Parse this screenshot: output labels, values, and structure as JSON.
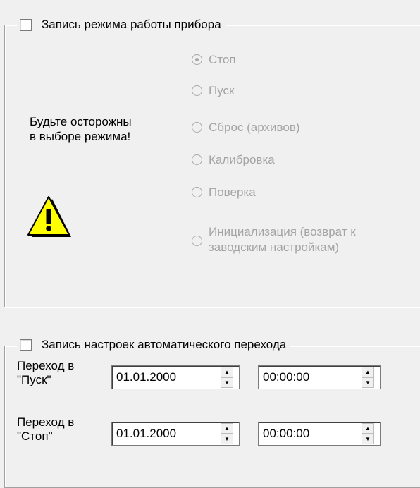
{
  "mode_group": {
    "title": "Запись режима работы прибора",
    "checked": false,
    "warning_line1": "Будьте осторожны",
    "warning_line2": "в выборе режима!",
    "warning_icon": "warning-icon",
    "options": [
      {
        "line1": "Стоп",
        "line2": "",
        "selected": true
      },
      {
        "line1": "Пуск",
        "line2": "",
        "selected": false
      },
      {
        "line1": "Сброс (архивов)",
        "line2": "",
        "selected": false
      },
      {
        "line1": "Калибровка",
        "line2": "",
        "selected": false
      },
      {
        "line1": "Поверка",
        "line2": "",
        "selected": false
      },
      {
        "line1": "Инициализация (возврат к",
        "line2": "заводским настройкам)",
        "selected": false
      }
    ]
  },
  "auto_group": {
    "title": "Запись настроек автоматического перехода",
    "checked": false,
    "rows": [
      {
        "label_line1": "Переход в",
        "label_line2": "\"Пуск\"",
        "date": "01.01.2000",
        "time": "00:00:00"
      },
      {
        "label_line1": "Переход в",
        "label_line2": "\"Стоп\"",
        "date": "01.01.2000",
        "time": "00:00:00"
      }
    ]
  },
  "colors": {
    "disabled_text": "#a4a4a4",
    "warning_yellow": "#ffff00"
  }
}
